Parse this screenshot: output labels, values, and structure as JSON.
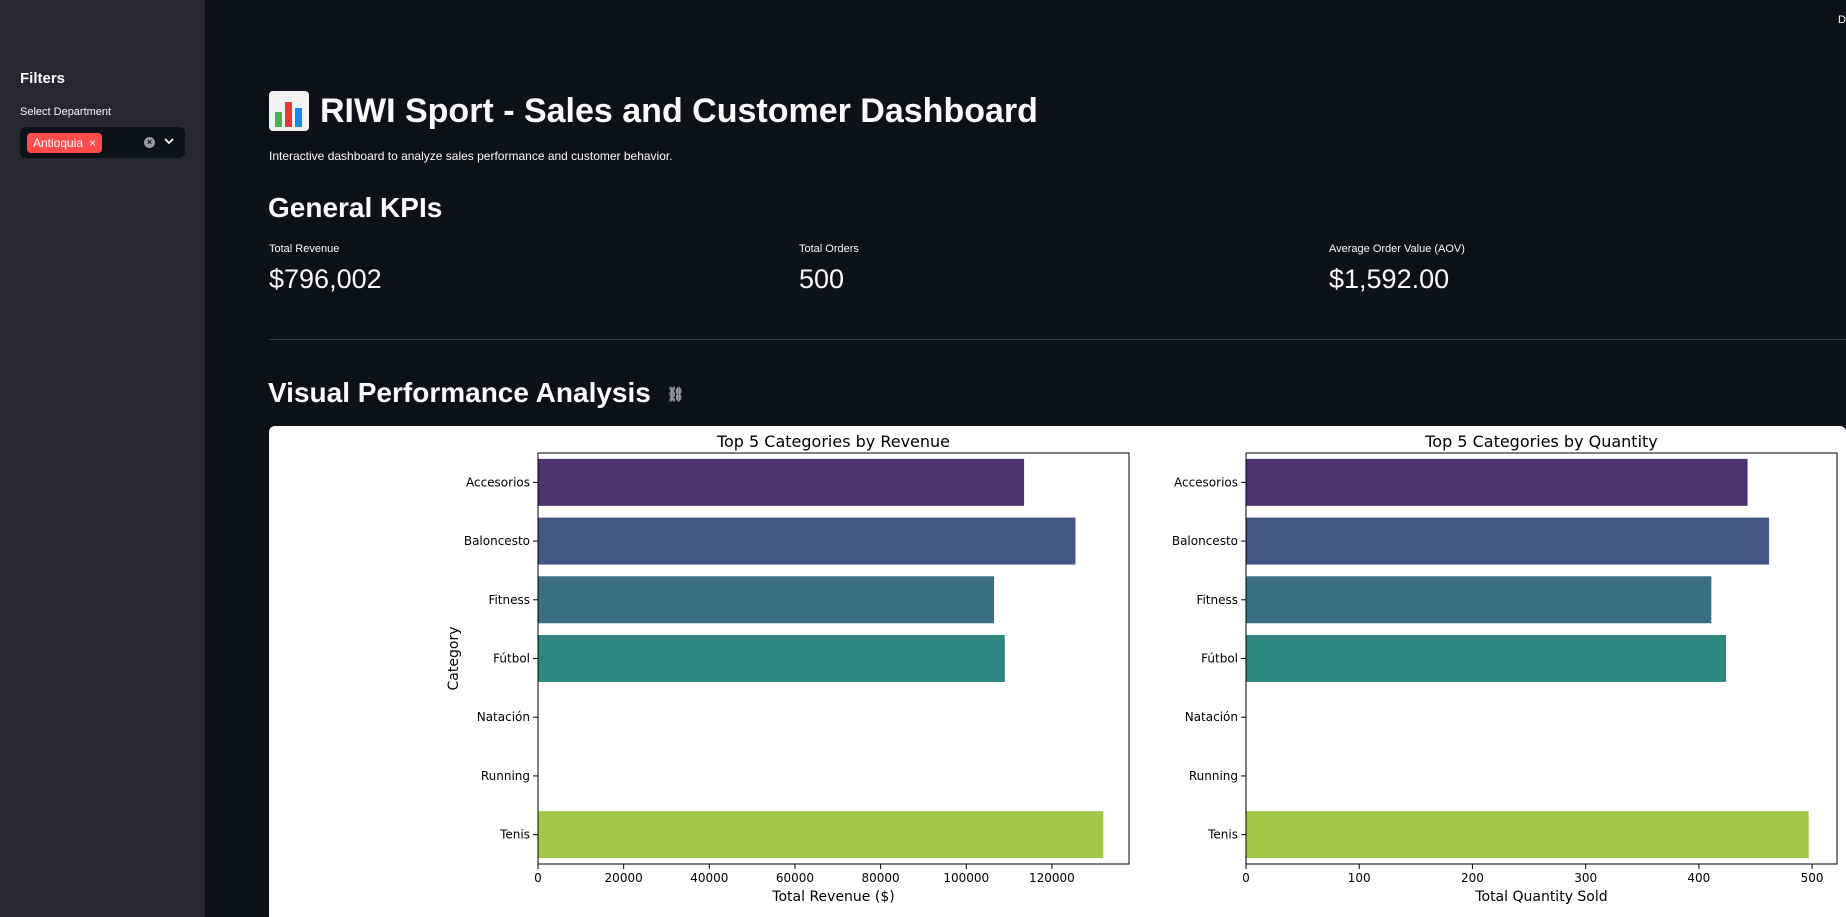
{
  "sidebar": {
    "heading": "Filters",
    "department_label": "Select Department",
    "selected": [
      "Antioquia"
    ],
    "chip_remove": "×"
  },
  "header": {
    "deploy_text": "D",
    "title": "RIWI Sport - Sales and Customer Dashboard",
    "title_icon": "bar-chart-icon",
    "subtitle": "Interactive dashboard to analyze sales performance and customer behavior."
  },
  "kpis": {
    "heading": "General KPIs",
    "items": [
      {
        "label": "Total Revenue",
        "value": "$796,002"
      },
      {
        "label": "Total Orders",
        "value": "500"
      },
      {
        "label": "Average Order Value (AOV)",
        "value": "$1,592.00"
      }
    ]
  },
  "analysis": {
    "heading": "Visual Performance Analysis",
    "anchor_icon": "link-icon"
  },
  "chart_data": [
    {
      "type": "bar",
      "orientation": "horizontal",
      "title": "Top 5 Categories by Revenue",
      "xlabel": "Total Revenue ($)",
      "ylabel": "Category",
      "categories": [
        "Accesorios",
        "Baloncesto",
        "Fitness",
        "Fútbol",
        "Natación",
        "Running",
        "Tenis"
      ],
      "values": [
        113500,
        125500,
        106500,
        109000,
        0,
        0,
        132000
      ],
      "colors": [
        "#4b3371",
        "#455586",
        "#3a6e82",
        "#2e8880",
        "#3ba477",
        "#6cbf56",
        "#a2c84a"
      ],
      "xlim": [
        0,
        138000
      ],
      "xticks": [
        0,
        20000,
        40000,
        60000,
        80000,
        100000,
        120000
      ]
    },
    {
      "type": "bar",
      "orientation": "horizontal",
      "title": "Top 5 Categories by Quantity",
      "xlabel": "Total Quantity Sold",
      "ylabel": "",
      "categories": [
        "Accesorios",
        "Baloncesto",
        "Fitness",
        "Fútbol",
        "Natación",
        "Running",
        "Tenis"
      ],
      "values": [
        443,
        462,
        411,
        424,
        0,
        0,
        497
      ],
      "colors": [
        "#4b3371",
        "#455586",
        "#3a6e82",
        "#2e8880",
        "#3ba477",
        "#6cbf56",
        "#a2c84a"
      ],
      "xlim": [
        0,
        522
      ],
      "xticks": [
        0,
        100,
        200,
        300,
        400,
        500
      ]
    }
  ]
}
